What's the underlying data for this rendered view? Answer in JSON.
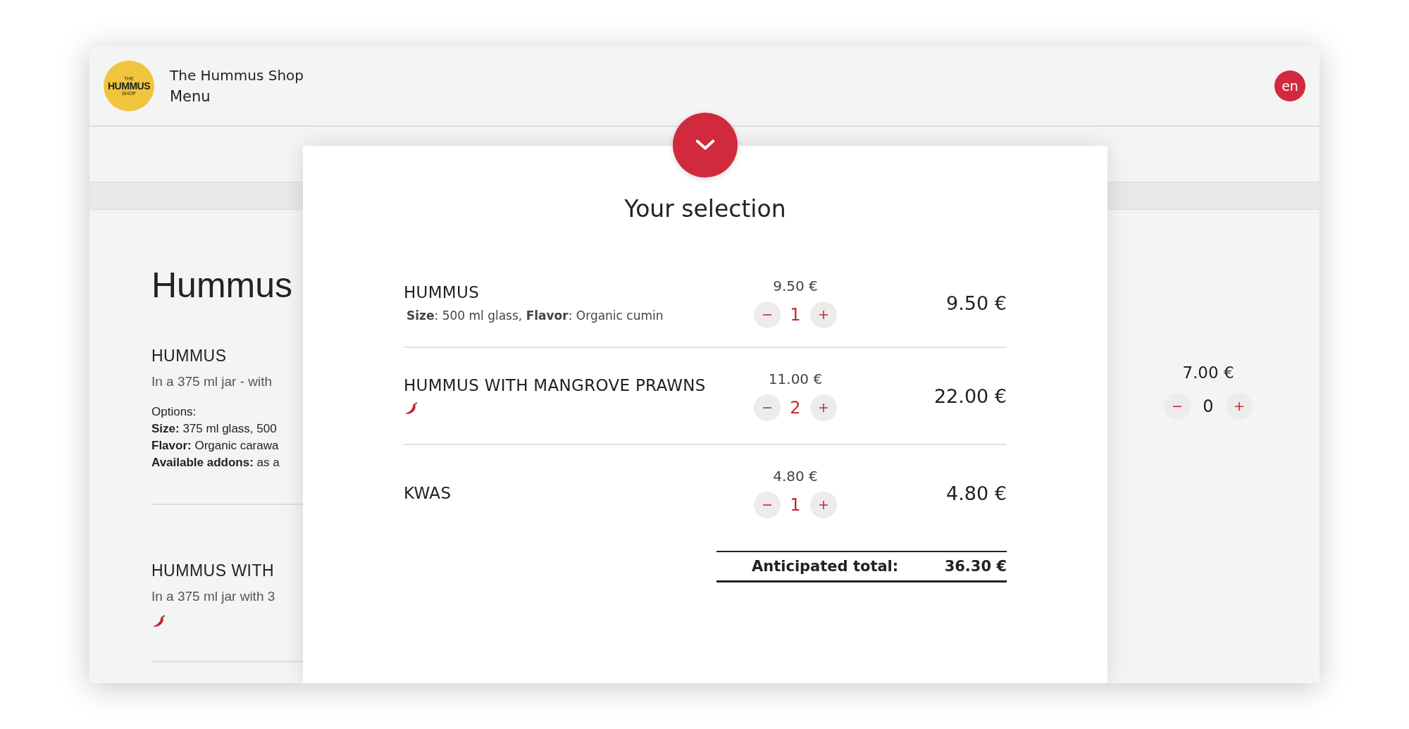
{
  "header": {
    "logo_lines": [
      "THE",
      "HUMMUS",
      "SHOP"
    ],
    "shop_name": "The Hummus Shop",
    "page_title": "Menu",
    "language": "en"
  },
  "menu": {
    "heading": "Hummus",
    "items": [
      {
        "name": "HUMMUS",
        "description": "In a 375 ml jar - with",
        "options_title": "Options:",
        "options": [
          "**Size:** 375 ml glass, 500",
          "**Flavor:** Organic carawa",
          "**Available addons:** as a"
        ],
        "spicy": false
      },
      {
        "name": "HUMMUS WITH",
        "description": "In a 375 ml jar with 3",
        "spicy": true
      }
    ],
    "side_item": {
      "price": "7.00 €",
      "quantity": "0"
    }
  },
  "selection": {
    "title": "Your selection",
    "items": [
      {
        "name": "HUMMUS",
        "details": "**Size**: 500 ml glass, **Flavor**: Organic cumin",
        "spicy": false,
        "unit_price": "9.50 €",
        "quantity": "1",
        "total": "9.50 €"
      },
      {
        "name": "HUMMUS WITH MANGROVE PRAWNS",
        "spicy": true,
        "unit_price": "11.00 €",
        "quantity": "2",
        "total": "22.00 €"
      },
      {
        "name": "KWAS",
        "spicy": false,
        "unit_price": "4.80 €",
        "quantity": "1",
        "total": "4.80 €"
      }
    ],
    "total_label": "Anticipated total:",
    "total": "36.30 €"
  }
}
